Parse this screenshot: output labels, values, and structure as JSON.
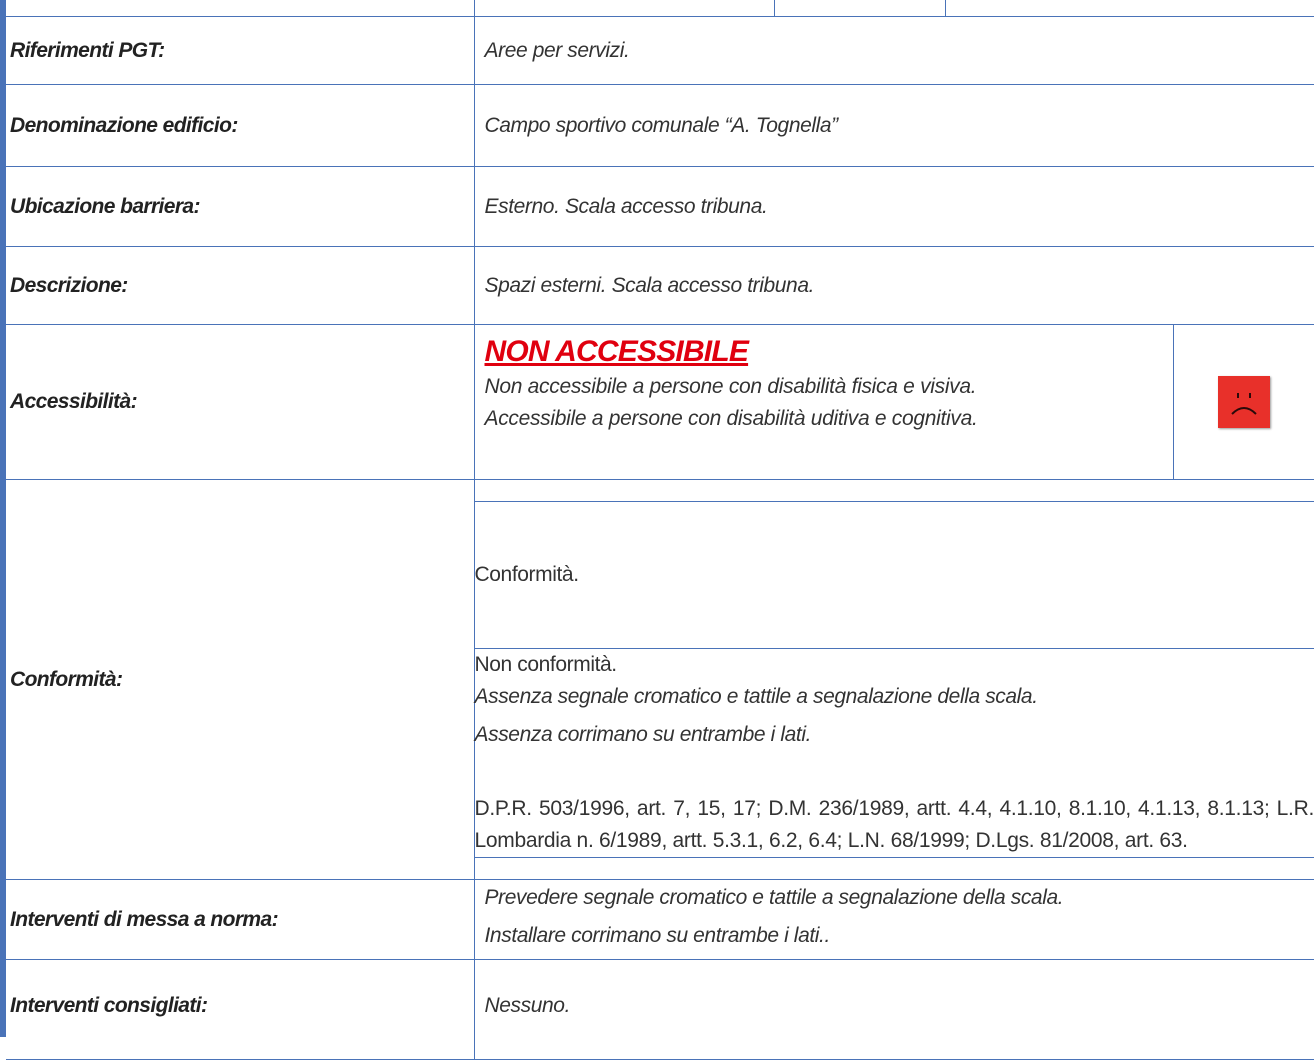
{
  "rows": {
    "pgt": {
      "label": "Riferimenti PGT:",
      "value": "Aree per servizi."
    },
    "building": {
      "label": "Denominazione edificio:",
      "value": "Campo sportivo comunale “A. Tognella”"
    },
    "location": {
      "label": "Ubicazione barriera:",
      "value": "Esterno. Scala accesso tribuna."
    },
    "description": {
      "label": "Descrizione:",
      "value": "Spazi esterni. Scala accesso tribuna."
    },
    "accessibility": {
      "label": "Accessibilità:",
      "status": "NON ACCESSIBILE",
      "line1": "Non accessibile a persone con disabilità fisica e visiva.",
      "line2": "Accessibile a persone con disabilità uditiva e cognitiva.",
      "icon": "sad-face-icon",
      "icon_color": "#e8302a",
      "status_color": "#e0000f"
    },
    "conformity": {
      "label": "Conformità:",
      "conform_title": "Conformità.",
      "nonconform_title": "Non conformità.",
      "issue1": "Assenza segnale cromatico e tattile a segnalazione della scala.",
      "issue2": "Assenza corrimano su entrambe i lati.",
      "references": "D.P.R. 503/1996, art. 7, 15, 17; D.M. 236/1989, artt. 4.4, 4.1.10, 8.1.10, 4.1.13, 8.1.13; L.R. Lombardia n. 6/1989, artt. 5.3.1, 6.2, 6.4; L.N. 68/1999; D.Lgs. 81/2008, art. 63."
    },
    "required": {
      "label": "Interventi di messa a norma:",
      "line1": "Prevedere segnale cromatico e tattile a segnalazione della scala.",
      "line2": "Installare corrimano su entrambe i lati.."
    },
    "advised": {
      "label": "Interventi consigliati:",
      "value": "Nessuno."
    }
  },
  "colors": {
    "border": "#4a73b8"
  }
}
